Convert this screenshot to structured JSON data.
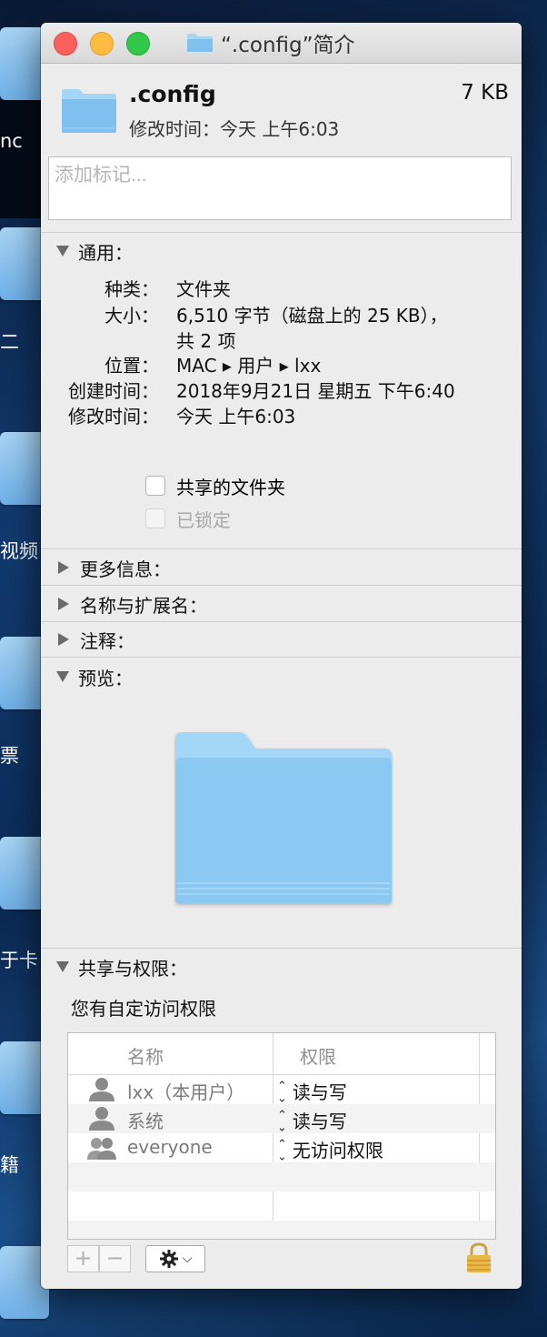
{
  "window": {
    "title": "“.config”简介"
  },
  "header": {
    "name": ".config",
    "size": "7 KB",
    "modified": "修改时间：今天 上午6:03"
  },
  "tags": {
    "placeholder": "添加标记..."
  },
  "general": {
    "section_label": "通用：",
    "rows": [
      {
        "key": "种类：",
        "value": "文件夹"
      },
      {
        "key": "大小：",
        "value": "6,510 字节（磁盘上的 25 KB），"
      },
      {
        "key": "",
        "value": "共 2 项"
      },
      {
        "key": "位置：",
        "value": "MAC ▸ 用户 ▸ lxx"
      },
      {
        "key": "创建时间：",
        "value": "2018年9月21日 星期五 下午6:40"
      },
      {
        "key": "修改时间：",
        "value": "今天 上午6:03"
      }
    ],
    "shared_folder_label": "共享的文件夹",
    "locked_label": "已锁定"
  },
  "sections": {
    "more_info": "更多信息：",
    "name_ext": "名称与扩展名：",
    "comments": "注释：",
    "preview": "预览：",
    "sharing": "共享与权限："
  },
  "permissions": {
    "note": "您有自定访问权限",
    "col_name": "名称",
    "col_priv": "权限",
    "rows": [
      {
        "name": "lxx（本用户）",
        "priv": "读与写"
      },
      {
        "name": "系统",
        "priv": "读与写"
      },
      {
        "name": "everyone",
        "priv": "无访问权限"
      }
    ],
    "add": "+",
    "remove": "−"
  },
  "background": {
    "labels": [
      "nc",
      "二",
      "视频",
      "票",
      "于卡",
      "籍"
    ]
  },
  "colors": {
    "folder_blue": "#8cc9f2",
    "folder_tab": "#a4d6f7",
    "close": "#fc605c",
    "minimize": "#fdbc40",
    "maximize": "#34c84a"
  }
}
